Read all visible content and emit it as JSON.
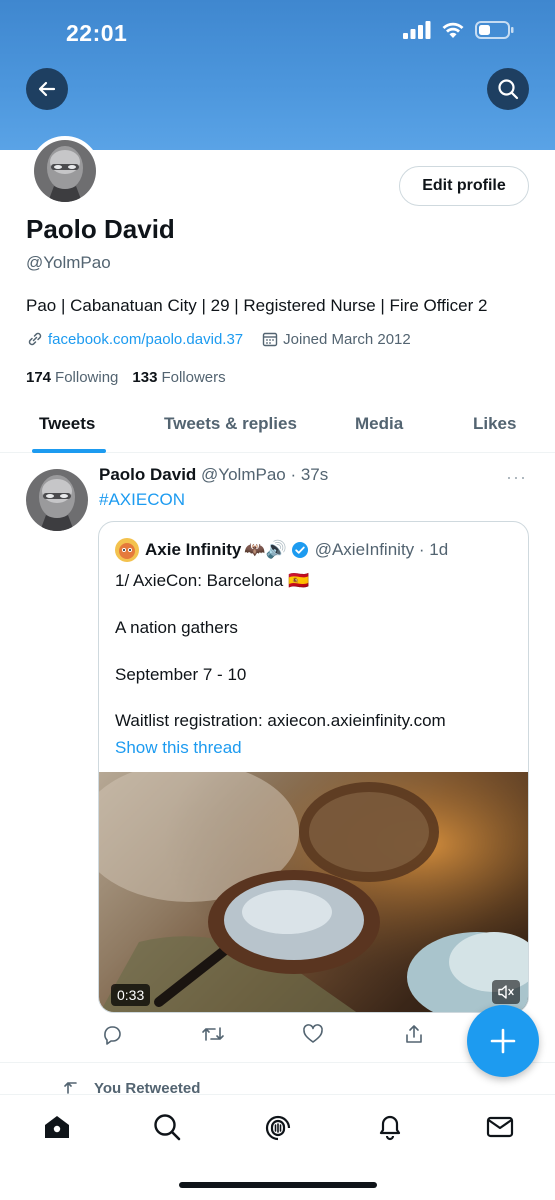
{
  "status_bar": {
    "time": "22:01"
  },
  "profile": {
    "name": "Paolo David",
    "handle": "@YolmPao",
    "bio": "Pao | Cabanatuan City | 29 | Registered Nurse | Fire Officer 2",
    "link": "facebook.com/paolo.david.37",
    "joined": "Joined March 2012",
    "following_count": "174",
    "following_label": "Following",
    "followers_count": "133",
    "followers_label": "Followers",
    "edit_label": "Edit profile"
  },
  "tabs": [
    {
      "label": "Tweets",
      "active": true
    },
    {
      "label": "Tweets & replies",
      "active": false
    },
    {
      "label": "Media",
      "active": false
    },
    {
      "label": "Likes",
      "active": false
    }
  ],
  "tweet": {
    "author_name": "Paolo David",
    "author_handle": "@YolmPao · 37s",
    "more": "···",
    "text": "#AXIECON",
    "quoted": {
      "author_name": "Axie Infinity",
      "emojis": "🦇🔊",
      "author_handle": "@AxieInfinity · 1d",
      "lines": [
        "1/ AxieCon: Barcelona 🇪🇸",
        "A nation gathers",
        "September 7 - 10",
        "Waitlist registration: axiecon.axieinfinity.com"
      ],
      "show_thread": "Show this thread",
      "video_duration": "0:33"
    }
  },
  "retweet_row": {
    "label": "You Retweeted"
  },
  "colors": {
    "accent": "#1d9bf0",
    "banner": "#4d97dd",
    "text": "#0f1419",
    "muted": "#536471"
  },
  "icons": [
    "back-arrow-icon",
    "search-icon",
    "link-icon",
    "calendar-icon",
    "reply-icon",
    "retweet-icon",
    "like-icon",
    "share-icon",
    "compose-icon",
    "home-icon",
    "explore-icon",
    "spaces-icon",
    "notifications-icon",
    "messages-icon",
    "mute-icon",
    "verified-icon",
    "more-icon"
  ]
}
